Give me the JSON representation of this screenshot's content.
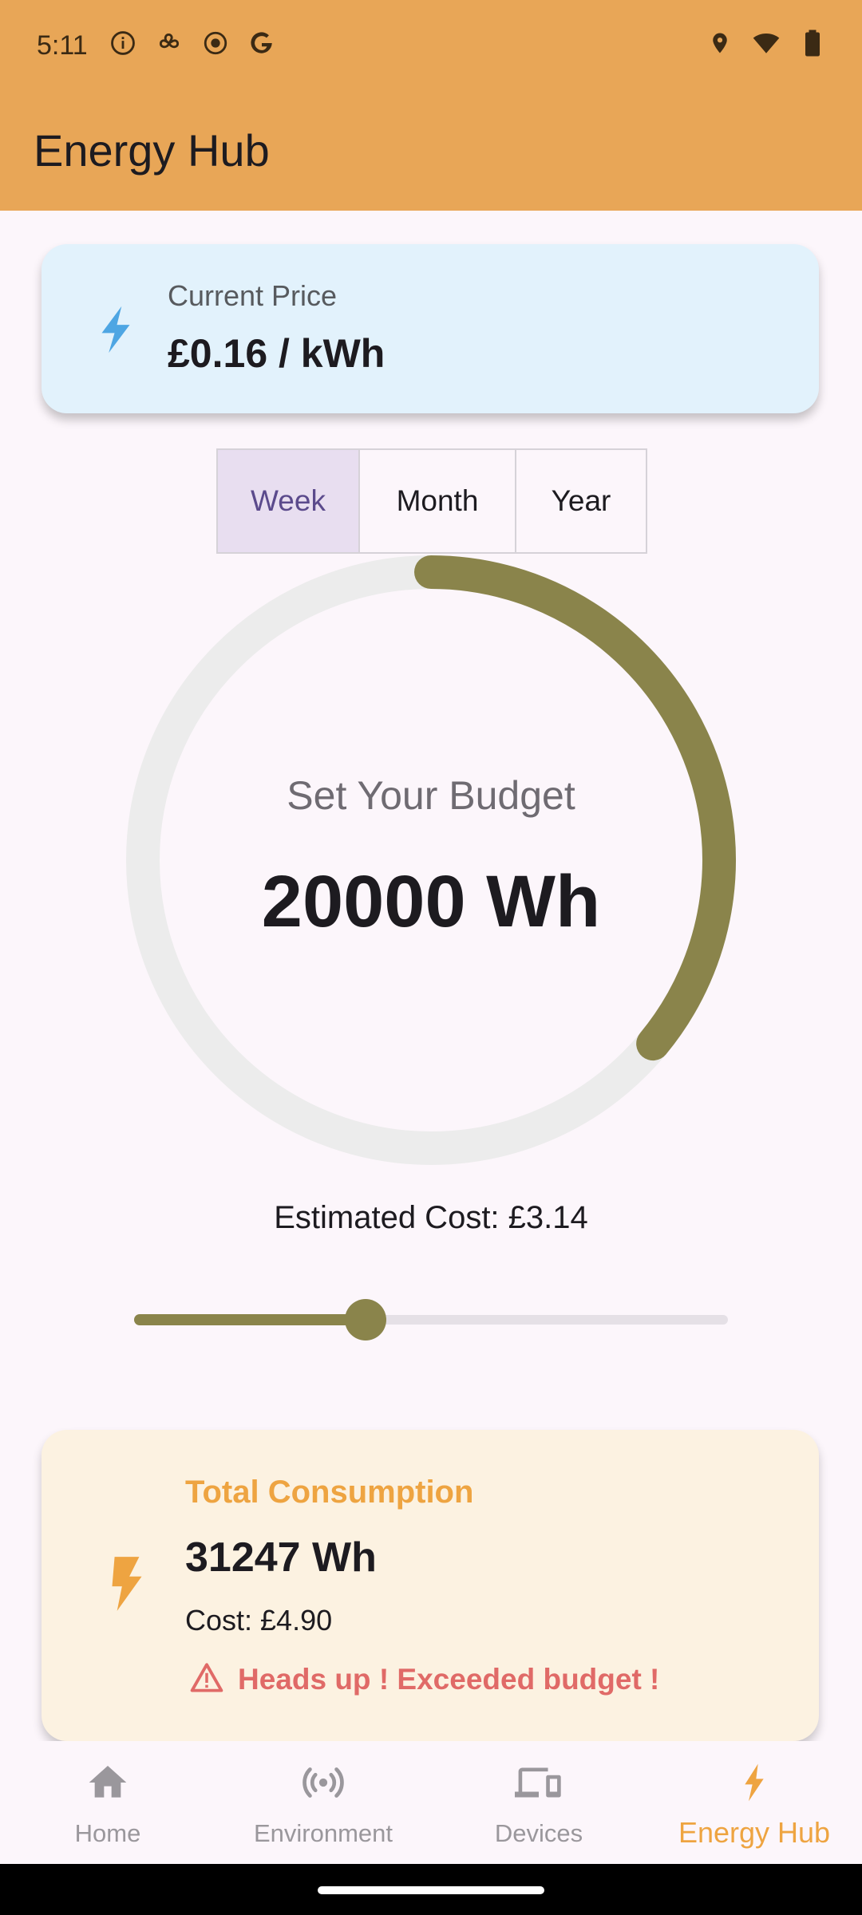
{
  "status_bar": {
    "time": "5:11",
    "left_icons": [
      "info-icon",
      "fan-icon",
      "record-icon",
      "google-icon"
    ],
    "right_icons": [
      "location-icon",
      "wifi-icon",
      "battery-icon"
    ]
  },
  "app_bar": {
    "title": "Energy Hub",
    "color": "#e8a657"
  },
  "price_card": {
    "label": "Current Price",
    "value": "£0.16 / kWh",
    "icon": "bolt-icon",
    "background": "#e2f2fc"
  },
  "period_selector": {
    "options": [
      "Week",
      "Month",
      "Year"
    ],
    "selected": "Week"
  },
  "budget_gauge": {
    "label": "Set Your Budget",
    "value": "20000 Wh",
    "progress_fraction": 0.36,
    "color": "#8a844b"
  },
  "estimated_cost": "Estimated Cost: £3.14",
  "budget_slider": {
    "fraction": 0.39
  },
  "consumption_card": {
    "title": "Total Consumption",
    "value": "31247 Wh",
    "cost": "Cost: £4.90",
    "warning": "Heads up ! Exceeded budget !",
    "icon": "bolt-icon",
    "accent": "#eea441",
    "warning_color": "#e06a67"
  },
  "bottom_nav": {
    "items": [
      {
        "label": "Home",
        "icon": "home-icon"
      },
      {
        "label": "Environment",
        "icon": "sensors-icon"
      },
      {
        "label": "Devices",
        "icon": "devices-icon"
      },
      {
        "label": "Energy Hub",
        "icon": "bolt-icon"
      }
    ],
    "active": "Energy Hub"
  }
}
